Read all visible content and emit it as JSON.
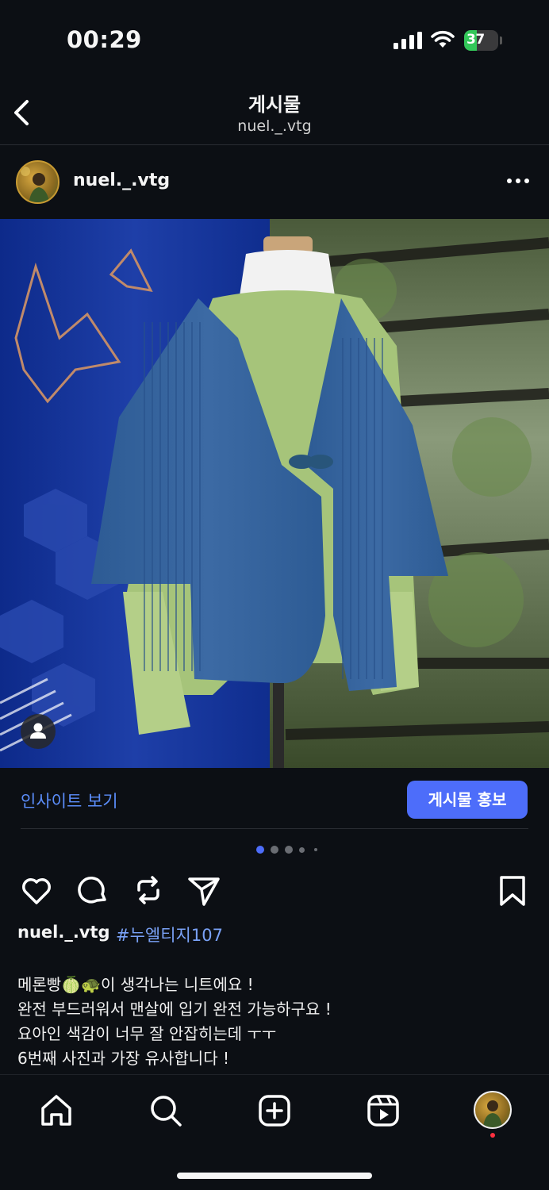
{
  "status_bar": {
    "time": "00:29",
    "battery": "37",
    "battery_level": 0.37
  },
  "header": {
    "title": "게시물",
    "subtitle": "nuel._.vtg"
  },
  "post": {
    "username": "nuel._.vtg",
    "image_count": 5,
    "current_image": 1
  },
  "insights": {
    "view_label": "인사이트 보기",
    "promote_label": "게시물 홍보"
  },
  "caption": {
    "username": "nuel._.vtg",
    "hashtag": "#누엘티지107",
    "text": "메론빵🍈🐢이 생각나는 니트에요 !\n완전 부드러워서 맨살에 입기 완전 가능하구요 !\n요아인 색감이 너무 잘 안잡히는데 ㅜㅜ\n6번째 사진과 가장 유사합니다 !"
  },
  "icons": {
    "back": "chevron-left-icon",
    "more": "more-horizontal-icon",
    "like": "heart-icon",
    "comment": "comment-icon",
    "repost": "repost-icon",
    "share": "send-icon",
    "save": "bookmark-icon",
    "home": "home-icon",
    "search": "search-icon",
    "create": "plus-square-icon",
    "reels": "reels-icon"
  },
  "colors": {
    "accent": "#4d6dfa",
    "link": "#5b8dfa",
    "hashtag": "#7aa2f7",
    "background": "#0c0f14",
    "notification": "#ff3040"
  }
}
